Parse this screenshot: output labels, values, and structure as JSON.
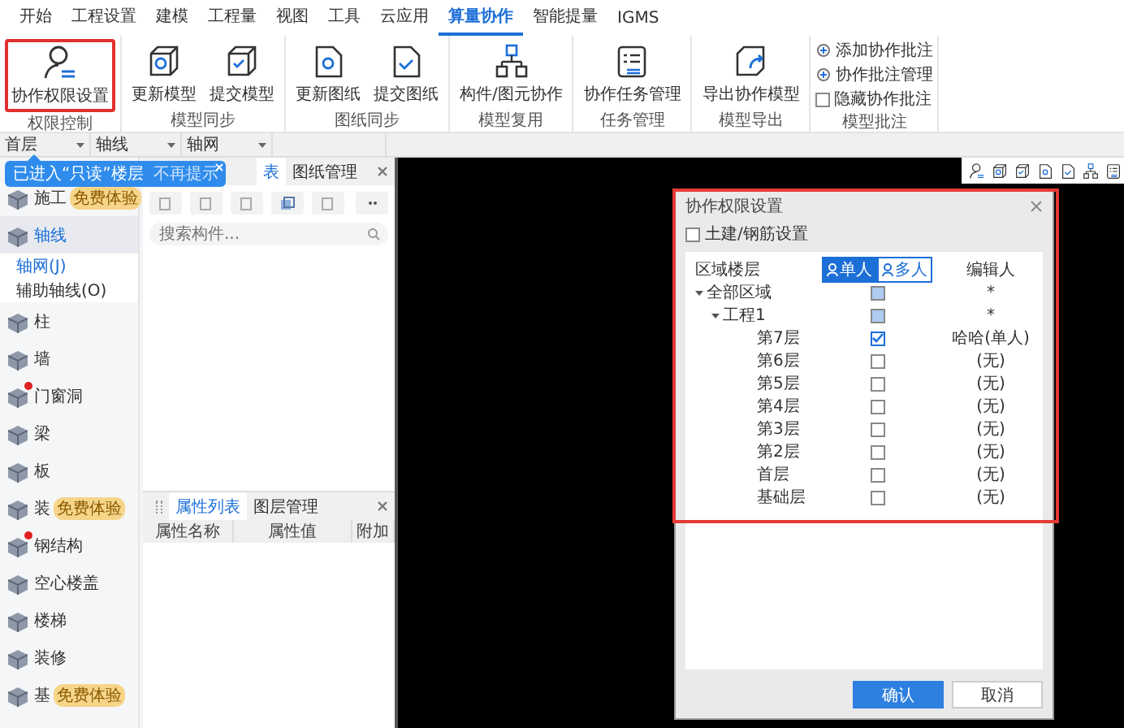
{
  "menu": [
    {
      "label": "开始",
      "selected": false
    },
    {
      "label": "工程设置",
      "selected": false
    },
    {
      "label": "建模",
      "selected": false
    },
    {
      "label": "工程量",
      "selected": false
    },
    {
      "label": "视图",
      "selected": false
    },
    {
      "label": "工具",
      "selected": false
    },
    {
      "label": "云应用",
      "selected": false
    },
    {
      "label": "算量协作",
      "selected": true
    },
    {
      "label": "智能提量",
      "selected": false
    },
    {
      "label": "IGMS",
      "selected": false
    }
  ],
  "ribbon": [
    {
      "name": "权限控制",
      "buttons": [
        {
          "kind": "large",
          "label": "协作权限设置",
          "highlighted": true
        }
      ]
    },
    {
      "name": "模型同步",
      "buttons": [
        {
          "kind": "large",
          "label": "更新模型",
          "highlighted": false
        },
        {
          "kind": "large",
          "label": "提交模型",
          "highlighted": false
        }
      ]
    },
    {
      "name": "图纸同步",
      "buttons": [
        {
          "kind": "large",
          "label": "更新图纸",
          "highlighted": false
        },
        {
          "kind": "large",
          "label": "提交图纸",
          "highlighted": false
        }
      ]
    },
    {
      "name": "模型复用",
      "buttons": [
        {
          "kind": "large",
          "label": "构件/图元协作",
          "highlighted": false
        }
      ]
    },
    {
      "name": "任务管理",
      "buttons": [
        {
          "kind": "large",
          "label": "协作任务管理",
          "highlighted": false
        }
      ]
    },
    {
      "name": "模型导出",
      "buttons": [
        {
          "kind": "large",
          "label": "导出协作模型",
          "highlighted": false
        }
      ]
    },
    {
      "name": "模型批注",
      "buttons": [
        {
          "kind": "small",
          "label": "添加协作批注"
        },
        {
          "kind": "small",
          "label": "协作批注管理"
        },
        {
          "kind": "check",
          "label": "隐藏协作批注",
          "checked": false
        }
      ]
    }
  ],
  "selectors": [
    "首层",
    "轴线",
    "轴网"
  ],
  "tooltip": {
    "text": "已进入“只读”楼层",
    "action": "不再提示"
  },
  "sidebar": {
    "items": [
      {
        "label": "施工",
        "selected": false,
        "dot": false,
        "badge": "免费体验"
      },
      {
        "label": "轴线",
        "selected": true,
        "dot": false,
        "children": [
          {
            "label": "轴网(J)",
            "selected": true
          },
          {
            "label": "辅助轴线(O)",
            "selected": false
          }
        ]
      },
      {
        "label": "柱",
        "selected": false,
        "dot": false
      },
      {
        "label": "墙",
        "selected": false,
        "dot": false
      },
      {
        "label": "门窗洞",
        "selected": false,
        "dot": true
      },
      {
        "label": "梁",
        "selected": false,
        "dot": false
      },
      {
        "label": "板",
        "selected": false,
        "dot": false
      },
      {
        "label": "装",
        "selected": false,
        "dot": false,
        "badge": "免费体验"
      },
      {
        "label": "钢结构",
        "selected": false,
        "dot": true
      },
      {
        "label": "空心楼盖",
        "selected": false,
        "dot": false
      },
      {
        "label": "楼梯",
        "selected": false,
        "dot": false
      },
      {
        "label": "装修",
        "selected": false,
        "dot": false
      },
      {
        "label": "基",
        "selected": false,
        "dot": false,
        "badge": "免费体验"
      }
    ]
  },
  "component_panel": {
    "tabs": [
      {
        "label": "表",
        "selected": true
      },
      {
        "label": "图纸管理",
        "selected": false
      }
    ],
    "search": {
      "placeholder": "搜索构件..."
    }
  },
  "property_panel": {
    "tabs": [
      {
        "label": "属性列表",
        "selected": true
      },
      {
        "label": "图层管理",
        "selected": false
      }
    ],
    "columns": [
      "属性名称",
      "属性值",
      "附加"
    ]
  },
  "dialog": {
    "title": "协作权限设置",
    "highlighted": true,
    "option": {
      "label": "土建/钢筋设置",
      "checked": false
    },
    "columns": {
      "area": "区域楼层",
      "editor": "编辑人"
    },
    "modes": [
      {
        "label": "单人",
        "selected": true
      },
      {
        "label": "多人",
        "selected": false
      }
    ],
    "tree": [
      {
        "label": "全部区域",
        "expanded": true,
        "checked": false,
        "partial": true,
        "editor": "*",
        "children": [
          {
            "label": "工程1",
            "expanded": true,
            "checked": false,
            "partial": true,
            "editor": "*",
            "children": [
              {
                "label": "第7层",
                "checked": true,
                "partial": false,
                "editor": "哈哈(单人)"
              },
              {
                "label": "第6层",
                "checked": false,
                "partial": false,
                "editor": "(无)"
              },
              {
                "label": "第5层",
                "checked": false,
                "partial": false,
                "editor": "(无)"
              },
              {
                "label": "第4层",
                "checked": false,
                "partial": false,
                "editor": "(无)"
              },
              {
                "label": "第3层",
                "checked": false,
                "partial": false,
                "editor": "(无)"
              },
              {
                "label": "第2层",
                "checked": false,
                "partial": false,
                "editor": "(无)"
              },
              {
                "label": "首层",
                "checked": false,
                "partial": false,
                "editor": "(无)"
              },
              {
                "label": "基础层",
                "checked": false,
                "partial": false,
                "editor": "(无)"
              }
            ]
          }
        ]
      }
    ],
    "buttons": [
      {
        "label": "确认",
        "kind": "primary"
      },
      {
        "label": "取消",
        "kind": "secondary"
      }
    ]
  }
}
